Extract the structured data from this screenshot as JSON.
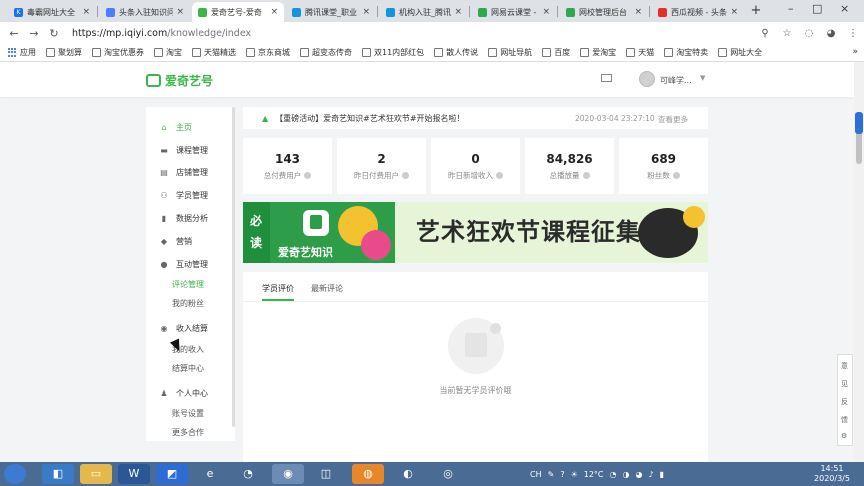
{
  "browser": {
    "tabs": [
      {
        "label": "毒霸网址大全",
        "color": "#1a73e8",
        "glyph": "K",
        "active": false
      },
      {
        "label": "头条入驻知识问",
        "color": "#4d7cff",
        "glyph": "",
        "active": false
      },
      {
        "label": "爱奇艺号-爱奇",
        "color": "#3ab54a",
        "glyph": "",
        "active": true
      },
      {
        "label": "腾讯课堂_职业",
        "color": "#1296db",
        "glyph": "",
        "active": false
      },
      {
        "label": "机构入驻_腾讯",
        "color": "#1296db",
        "glyph": "",
        "active": false
      },
      {
        "label": "网易云课堂 - 我",
        "color": "#2fa84f",
        "glyph": "",
        "active": false
      },
      {
        "label": "网校管理后台",
        "color": "#2fa84f",
        "glyph": "",
        "active": false
      },
      {
        "label": "西瓜视频 - 头条",
        "color": "#e0312a",
        "glyph": "",
        "active": false
      }
    ],
    "url_host": "https://mp.iqiyi.com",
    "url_path": "/knowledge/index",
    "bookmarks": [
      "应用",
      "聚划算",
      "淘宝优惠券",
      "淘宝",
      "天猫精选",
      "京东商城",
      "超变态传奇",
      "双11内部红包",
      "散人传说",
      "网址导航",
      "百度",
      "爱淘宝",
      "天猫",
      "淘宝特卖",
      "网址大全"
    ]
  },
  "header": {
    "logo_text": "爱奇艺号",
    "username": "可峰学..."
  },
  "sidebar": {
    "items": [
      {
        "label": "主页",
        "icon": "home-icon",
        "glyph": "⌂",
        "active": true
      },
      {
        "label": "课程管理",
        "icon": "folder-icon",
        "glyph": "▬",
        "active": false
      },
      {
        "label": "店铺管理",
        "icon": "shop-icon",
        "glyph": "▤",
        "active": false
      },
      {
        "label": "学员管理",
        "icon": "users-icon",
        "glyph": "⚇",
        "active": false
      },
      {
        "label": "数据分析",
        "icon": "chart-icon",
        "glyph": "▮",
        "active": false
      },
      {
        "label": "营销",
        "icon": "tag-icon",
        "glyph": "◆",
        "active": false
      },
      {
        "label": "互动管理",
        "icon": "chat-icon",
        "glyph": "●",
        "active": false
      }
    ],
    "interaction_subs": [
      "评论管理",
      "我的粉丝"
    ],
    "income": {
      "label": "收入结算",
      "icon": "coin-icon",
      "glyph": "◉",
      "subs": [
        "我的收入",
        "结算中心"
      ]
    },
    "personal": {
      "label": "个人中心",
      "icon": "person-icon",
      "glyph": "♟",
      "subs": [
        "账号设置",
        "更多合作"
      ]
    }
  },
  "notice": {
    "text": "【重磅活动】爱奇艺知识#艺术狂欢节#开始报名啦！",
    "date": "2020-03-04 23:27:10",
    "more": "查看更多"
  },
  "stats": [
    {
      "value": "143",
      "label": "总付费用户"
    },
    {
      "value": "2",
      "label": "昨日付费用户"
    },
    {
      "value": "0",
      "label": "昨日新增收入"
    },
    {
      "value": "84,826",
      "label": "总播放量"
    },
    {
      "value": "689",
      "label": "粉丝数"
    }
  ],
  "banner": {
    "side_text": [
      "必",
      "读"
    ],
    "brand": "爱奇艺知识",
    "title": "艺术狂欢节课程征集"
  },
  "content": {
    "tabs": [
      "学员评价",
      "最新评论"
    ],
    "empty_text": "当前暂无学员评价哦"
  },
  "side_tool": {
    "labels": [
      "意",
      "见",
      "反",
      "馈"
    ]
  },
  "taskbar": {
    "tray_text": "CH",
    "temp": "12°C",
    "time": "14:51",
    "date": "2020/3/5"
  }
}
